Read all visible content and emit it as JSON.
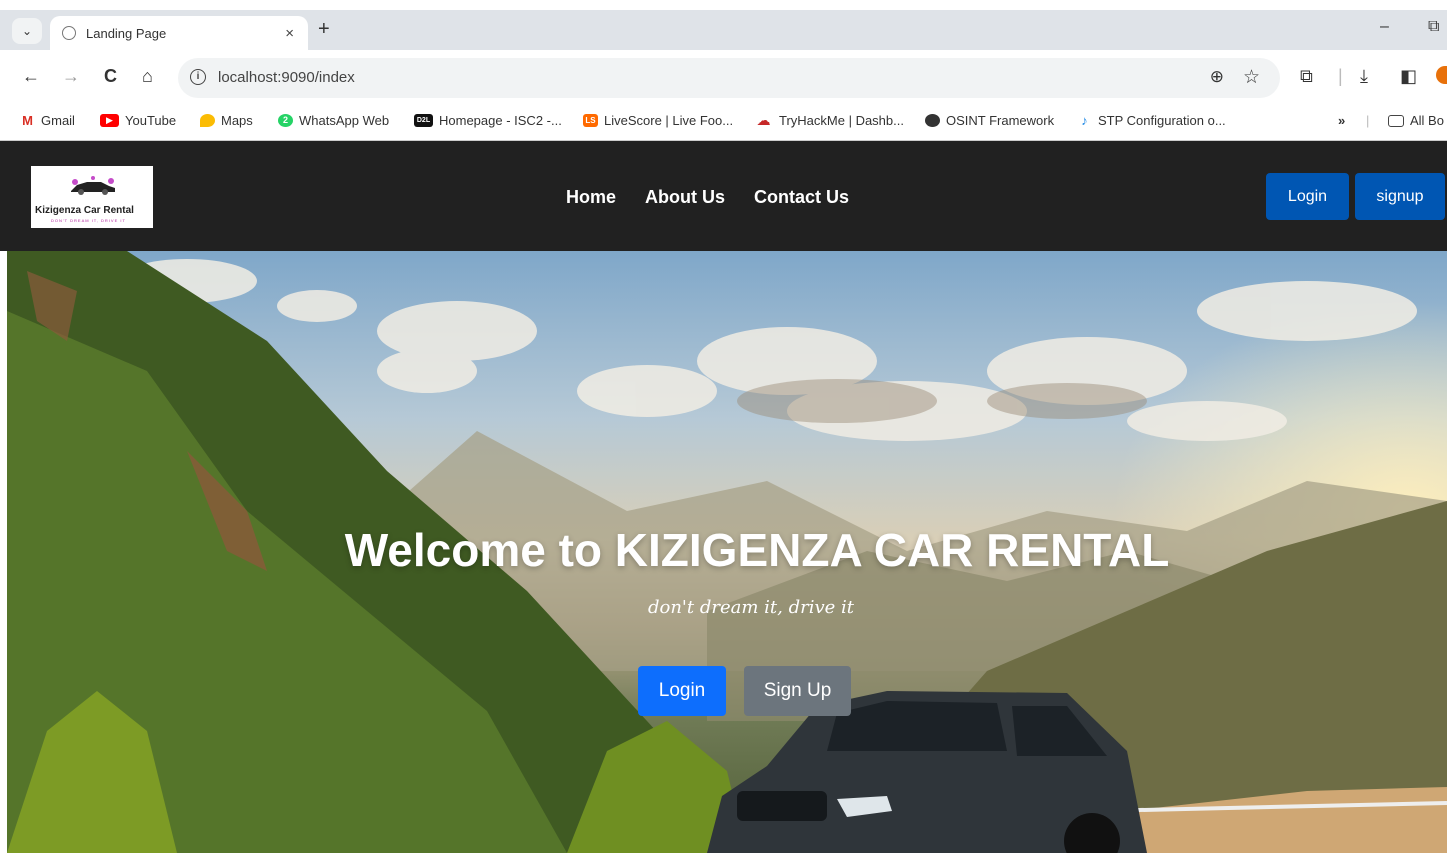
{
  "browser": {
    "tab": {
      "title": "Landing Page",
      "close": "×"
    },
    "new_tab": "+",
    "window": {
      "minimize": "–",
      "restore": "⧉"
    },
    "nav": {
      "back": "←",
      "forward": "→",
      "reload": "C",
      "home": "⌂"
    },
    "url": "localhost:9090/index",
    "omnibox_icons": {
      "zoom": "⊕",
      "bookmark": "☆"
    },
    "toolbar_icons": {
      "extensions": "⧉",
      "downloads": "⤓",
      "sidepanel": "◧"
    },
    "bookmarks": [
      {
        "label": "Gmail",
        "icon": "M",
        "color": "#d93025"
      },
      {
        "label": "YouTube",
        "icon": "▶",
        "color": "#ff0000"
      },
      {
        "label": "Maps",
        "icon": "●",
        "color": "#34a853"
      },
      {
        "label": "WhatsApp Web",
        "icon": "2",
        "color": "#25d366"
      },
      {
        "label": "Homepage - ISC2 -...",
        "icon": "D2L",
        "color": "#111111"
      },
      {
        "label": "LiveScore | Live Foo...",
        "icon": "LS",
        "color": "#ff6a00"
      },
      {
        "label": "TryHackMe | Dashb...",
        "icon": "☁",
        "color": "#c62828"
      },
      {
        "label": "OSINT Framework",
        "icon": "◉",
        "color": "#333333"
      },
      {
        "label": "STP Configuration o...",
        "icon": "♪",
        "color": "#1e88e5"
      }
    ],
    "bookmarks_more": "»",
    "all_bookmarks": "All Bo"
  },
  "site": {
    "logo": {
      "name": "Kizigenza Car Rental",
      "slogan": "DON'T DREAM IT, DRIVE IT"
    },
    "menu": [
      "Home",
      "About Us",
      "Contact Us"
    ],
    "nav_login": "Login",
    "nav_signup": "signup",
    "hero": {
      "title": "Welcome to KIZIGENZA CAR RENTAL",
      "subtitle": "don't dream it, drive it",
      "login": "Login",
      "signup": "Sign Up"
    }
  },
  "colors": {
    "navbar": "#212121",
    "nav_button": "#0056b3",
    "hero_login": "#0d6efd",
    "hero_signup": "#6c757d"
  }
}
